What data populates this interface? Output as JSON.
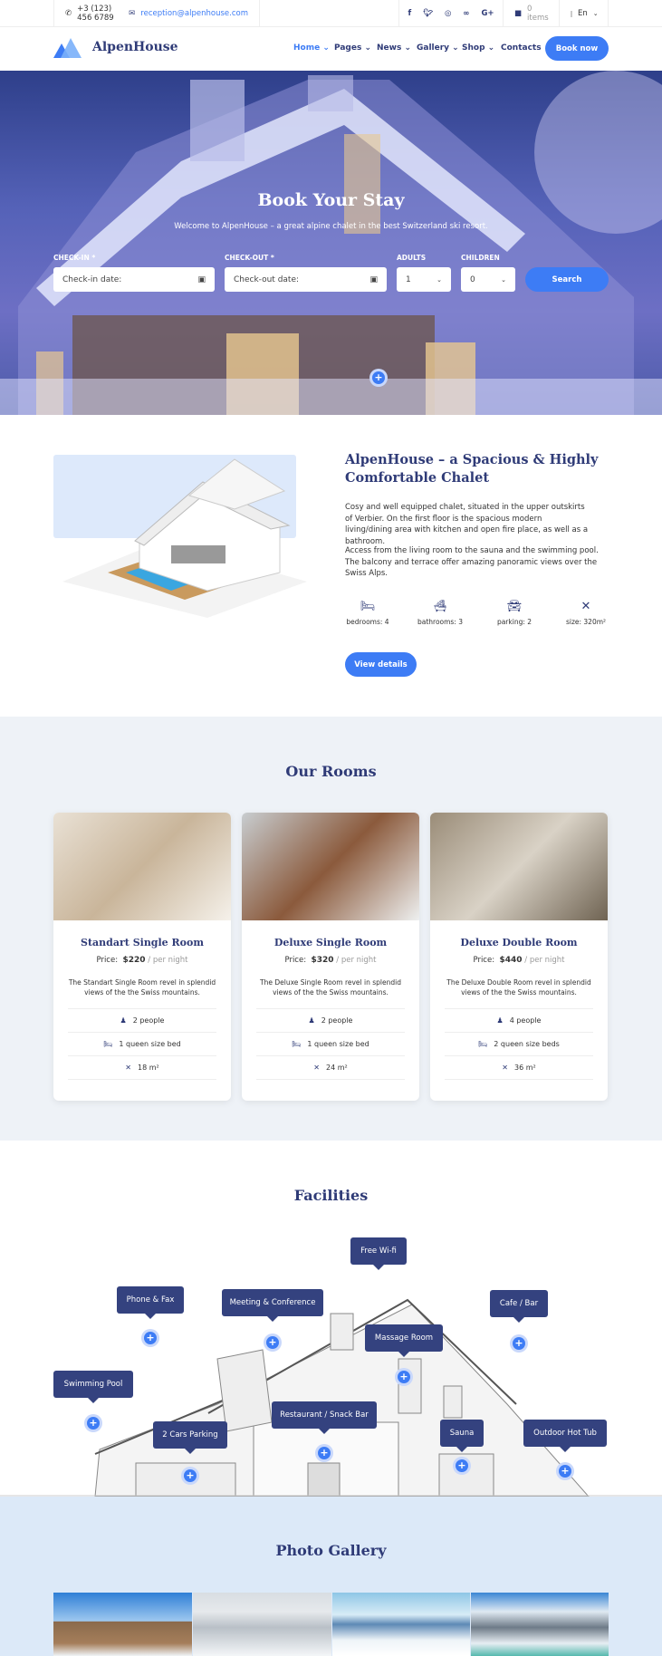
{
  "topbar": {
    "phone": "+3 (123) 456 6789",
    "email": "reception@alpenhouse.com",
    "social": [
      "f",
      "t",
      "ig",
      "ta",
      "G+"
    ],
    "cart": "0 items",
    "language": "En"
  },
  "nav": {
    "brand": "AlpenHouse",
    "items": [
      "Home",
      "Pages",
      "News",
      "Gallery",
      "Shop",
      "Contacts"
    ],
    "book": "Book now"
  },
  "hero": {
    "title": "Book Your Stay",
    "subtitle": "Welcome to AlpenHouse – a great alpine chalet in the best Switzerland ski resort.",
    "checkin_label": "CHECK-IN *",
    "checkin_placeholder": "Check-in date:",
    "checkout_label": "CHECK-OUT *",
    "checkout_placeholder": "Check-out date:",
    "adults_label": "ADULTS",
    "adults_value": "1",
    "children_label": "CHILDREN",
    "children_value": "0",
    "search": "Search"
  },
  "about": {
    "title": "AlpenHouse – a Spacious & Highly Comfortable Chalet",
    "p1": "Cosy and well equipped chalet, situated in the upper outskirts of Verbier. On the first floor is the spacious modern living/dining area with kitchen and open fire place, as well as a bathroom.",
    "p2": "Access from the living room to the sauna and the swimming pool. The balcony and terrace offer amazing panoramic views over the Swiss Alps.",
    "features": [
      {
        "icon": "bed-icon",
        "label": "bedrooms: 4"
      },
      {
        "icon": "bath-icon",
        "label": "bathrooms: 3"
      },
      {
        "icon": "car-icon",
        "label": "parking: 2"
      },
      {
        "icon": "expand-icon",
        "label": "size: 320m²"
      }
    ],
    "button": "View details"
  },
  "rooms": {
    "title": "Our Rooms",
    "price_label": "Price:",
    "per_night": "/ per night",
    "items": [
      {
        "name": "Standart Single Room",
        "price": "$220",
        "desc": "The Standart Single Room revel in splendid views of the the Swiss mountains.",
        "people": "2 people",
        "beds": "1 queen size bed",
        "size": "18 m²"
      },
      {
        "name": "Deluxe Single Room",
        "price": "$320",
        "desc": "The Deluxe Single Room revel in splendid views of the the Swiss mountains.",
        "people": "2 people",
        "beds": "1 queen size bed",
        "size": "24 m²"
      },
      {
        "name": "Deluxe Double Room",
        "price": "$440",
        "desc": "The Deluxe Double Room revel in splendid views of the the Swiss mountains.",
        "people": "4 people",
        "beds": "2 queen size beds",
        "size": "36 m²"
      }
    ]
  },
  "facilities": {
    "title": "Facilities",
    "items": [
      "Free Wi-fi",
      "Phone & Fax",
      "Meeting & Conference",
      "Cafe / Bar",
      "Massage Room",
      "Swimming Pool",
      "2 Cars Parking",
      "Restaurant / Snack Bar",
      "Sauna",
      "Outdoor Hot Tub"
    ]
  },
  "gallery": {
    "title": "Photo Gallery"
  },
  "colors": {
    "navy": "#2f3b77",
    "accent": "#3d7cf5",
    "rooms_bg": "#eef2f7",
    "gallery_bg": "#dce9f8"
  }
}
